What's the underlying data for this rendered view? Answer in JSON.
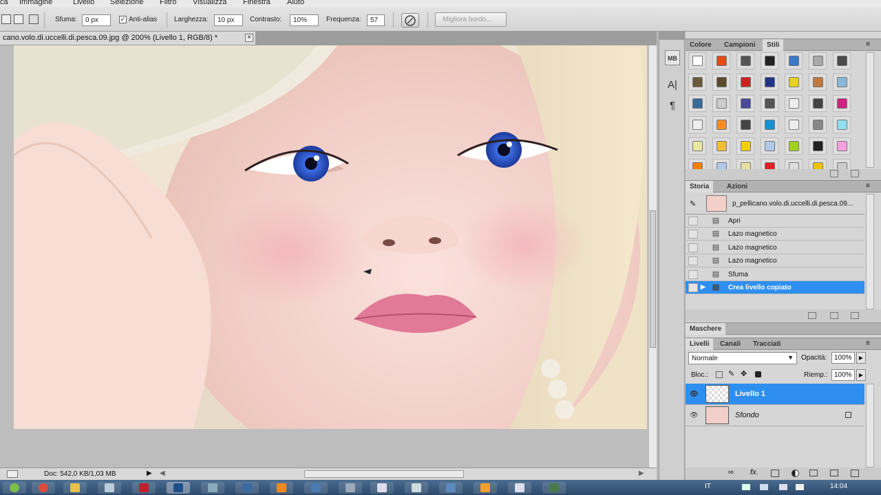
{
  "menu": [
    "ca",
    "Immagine",
    "Livello",
    "Selezione",
    "Filtro",
    "Visualizza",
    "Finestra",
    "Aiuto"
  ],
  "options": {
    "sfuma_label": "Sfuma:",
    "sfuma_value": "0 px",
    "antialias_label": "Anti-alias",
    "antialias_checked": "✓",
    "larghezza_label": "Larghezza:",
    "larghezza_value": "10 px",
    "contrasto_label": "Contrasto:",
    "contrasto_value": "10%",
    "frequenza_label": "Frequenza:",
    "frequenza_value": "57",
    "migliora_label": "Migliora bordo..."
  },
  "document": {
    "tab_title": "cano.volo.di.uccelli.di.pesca.09.jpg @ 200% (Livello 1, RGB/8) *",
    "close": "×"
  },
  "status": {
    "doc_info": "Doc: 542,0 KB/1,03 MB"
  },
  "dock_icons": [
    "mini-bridge-icon",
    "character-icon",
    "paragraph-icon"
  ],
  "dock_text": {
    "mb": "MB",
    "char": "A|",
    "para": "¶"
  },
  "swatches_panel": {
    "tabs": [
      "Colore",
      "Campioni",
      "Stili"
    ],
    "styles": [
      [
        "#ffffff",
        "#e8481a",
        "#555555",
        "#222222",
        "#3a78c8",
        "#a8a8a8",
        "#4a4a4a"
      ],
      [
        "#6b5a3a",
        "#5a4a2a",
        "#cc2222",
        "#223388",
        "#e8d020",
        "#c07840",
        "#8ab8d8"
      ],
      [
        "#3a6a9a",
        "#cccccc",
        "#4a4a9a",
        "#555555",
        "#eeeeee",
        "#444444",
        "#d02080"
      ],
      [
        "#eeeeee",
        "#f09020",
        "#444444",
        "#1a90d0",
        "#eeeeee",
        "#888888",
        "#90e0f0"
      ],
      [
        "#e8e8a0",
        "#f0c030",
        "#f0d000",
        "#b0c8e8",
        "#a0d020",
        "#222222",
        "#f8a0e0"
      ],
      [
        "#f08000",
        "#b0c8e8",
        "#e8e0a0",
        "#e02020",
        "#dddddd",
        "#f0c000",
        "#cccccc"
      ]
    ]
  },
  "history_panel": {
    "tabs": [
      "Storia",
      "Azioni"
    ],
    "snapshot": "p_pellicano.volo.di.uccelli.di.pesca.09...",
    "items": [
      "Apri",
      "Lazo magnetico",
      "Lazo magnetico",
      "Lazo magnetico",
      "Sfuma",
      "Crea livello copiato"
    ],
    "selected_index": 5
  },
  "masks_panel": {
    "tab": "Maschere"
  },
  "layers_panel": {
    "tabs": [
      "Livelli",
      "Canali",
      "Tracciati"
    ],
    "blend_mode": "Normale",
    "opacity_label": "Opacità:",
    "opacity_value": "100%",
    "lock_label": "Bloc.:",
    "fill_label": "Riemp.:",
    "fill_value": "100%",
    "layers": [
      {
        "name": "Livello 1",
        "selected": true
      },
      {
        "name": "Sfondo",
        "selected": false
      }
    ]
  },
  "taskbar": {
    "lang": "IT",
    "time": "14:04"
  }
}
